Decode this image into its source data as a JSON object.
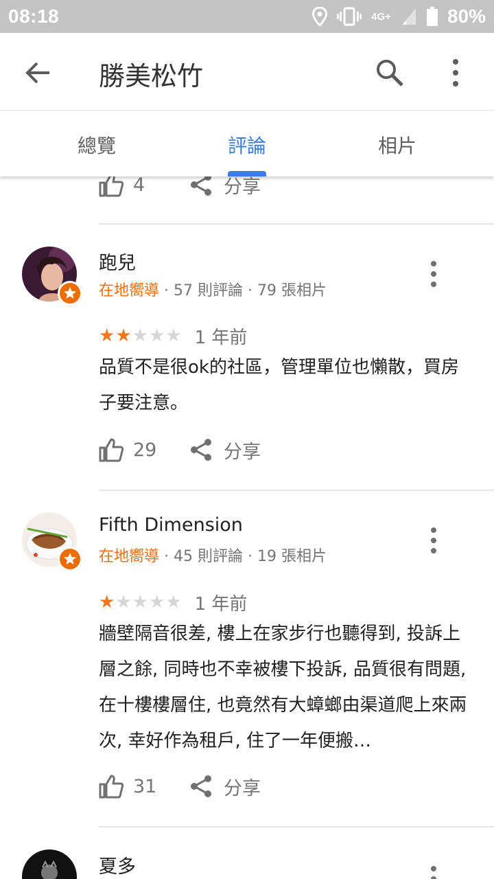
{
  "status_bar": {
    "time": "08:18",
    "network": "4G+",
    "battery": "80%"
  },
  "app_bar": {
    "title": "勝美松竹"
  },
  "tabs": [
    {
      "label": "總覽",
      "active": false
    },
    {
      "label": "評論",
      "active": true
    },
    {
      "label": "相片",
      "active": false
    }
  ],
  "previous_review": {
    "likes": "4",
    "share_label": "分享"
  },
  "reviews": [
    {
      "name": "跑兒",
      "badge": "在地嚮導",
      "meta": " · 57 則評論 · 79 張相片",
      "stars": 2,
      "time": "1 年前",
      "text": "品質不是很ok的社區，管理單位也懶散，買房子要注意。",
      "likes": "29",
      "share_label": "分享"
    },
    {
      "name": "Fifth Dimension",
      "badge": "在地嚮導",
      "meta": " · 45 則評論 · 19 張相片",
      "stars": 1,
      "time": "1 年前",
      "text": "牆壁隔音很差, 樓上在家步行也聽得到, 投訴上層之餘, 同時也不幸被樓下投訴, 品質很有問題, 在十樓樓層住, 也竟然有大蟑螂由渠道爬上來兩次, 幸好作為租戶, 住了一年便搬…",
      "likes": "31",
      "share_label": "分享"
    },
    {
      "name": "夏多"
    }
  ],
  "colors": {
    "accent": "#3b7de3",
    "local_guide": "#e8711a",
    "star_on": "#f0781c",
    "star_off": "#d6d6d6"
  }
}
